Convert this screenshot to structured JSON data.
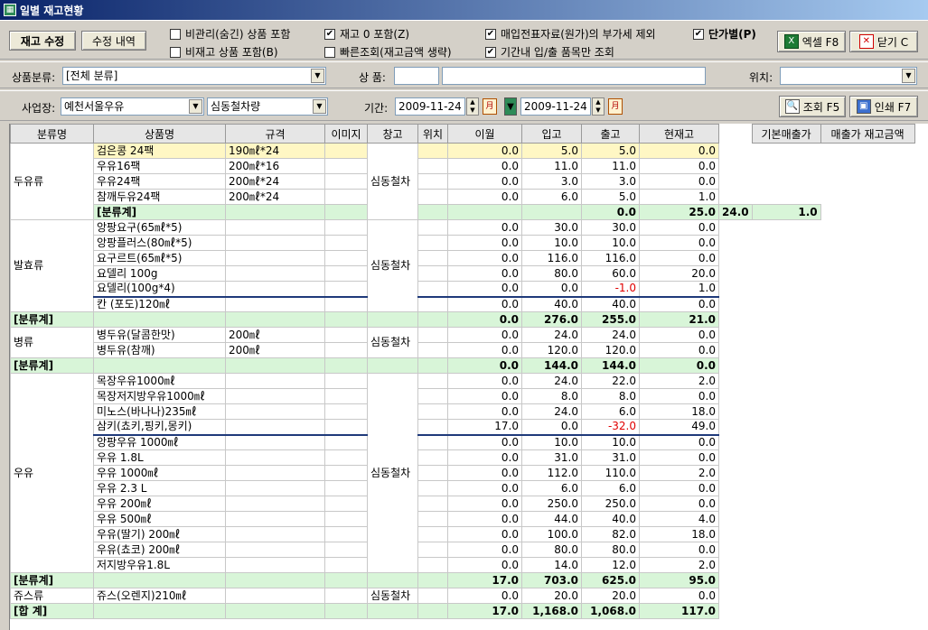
{
  "window": {
    "title": "일별 재고현황"
  },
  "toolbar": {
    "stock_edit": "재고 수정",
    "edit_history": "수정 내역",
    "chk_unmanaged": "비관리(숨긴) 상품 포함",
    "chk_nonstock": "비재고 상품 포함(B)",
    "chk_zero_stock": "재고 0 포함(Z)",
    "chk_quick": "빠른조회(재고금액 생략)",
    "chk_vat": "매입전표자료(원가)의 부가세 제외",
    "chk_period": "기간내 입/출 품목만 조회",
    "chk_unit_price": "단가별(P)",
    "excel": "엑셀 F8",
    "close": "닫기 C",
    "query": "조회 F5",
    "print": "인쇄 F7",
    "checked": "✔"
  },
  "filters": {
    "category_label": "상품분류:",
    "category_value": "[전체 분류]",
    "product_label": "상  품:",
    "location_label": "위치:",
    "site_label": "사업장:",
    "site_value": "예천서울우유",
    "warehouse_value": "심동철차량",
    "period_label": "기간:",
    "date_from": "2009-11-24",
    "date_to": "2009-11-24",
    "cal_glyph": "月"
  },
  "columns": [
    "분류명",
    "상품명",
    "규격",
    "이미지",
    "창고",
    "위치",
    "이월",
    "입고",
    "출고",
    "현재고",
    "기본매출가",
    "매출가 재고금액"
  ],
  "groups": {
    "g1": {
      "cat": "두유류",
      "wh": "심동철차"
    },
    "g2": {
      "cat": "발효류",
      "wh": "심동철차"
    },
    "g3": {
      "cat": "병류",
      "wh": "심동철차"
    },
    "g4": {
      "cat": "우유",
      "wh": "심동철차"
    },
    "g5": {
      "cat": "쥬스류",
      "wh": "심동철차"
    }
  },
  "rows": {
    "r0": {
      "name": "검은콩 24팩",
      "spec": "190㎖*24",
      "carry": "0.0",
      "in": "5.0",
      "out": "5.0",
      "stock": "0.0"
    },
    "r1": {
      "name": "우유16팩",
      "spec": "200㎖*16",
      "carry": "0.0",
      "in": "11.0",
      "out": "11.0",
      "stock": "0.0"
    },
    "r2": {
      "name": "우유24팩",
      "spec": "200㎖*24",
      "carry": "0.0",
      "in": "3.0",
      "out": "3.0",
      "stock": "0.0"
    },
    "r3": {
      "name": "참깨두유24팩",
      "spec": "200㎖*24",
      "carry": "0.0",
      "in": "6.0",
      "out": "5.0",
      "stock": "1.0"
    },
    "s1": {
      "label": "[분류계]",
      "carry": "0.0",
      "in": "25.0",
      "out": "24.0",
      "stock": "1.0"
    },
    "r4": {
      "name": "앙팡요구(65㎖*5)",
      "carry": "0.0",
      "in": "30.0",
      "out": "30.0",
      "stock": "0.0"
    },
    "r5": {
      "name": "앙팡플러스(80㎖*5)",
      "carry": "0.0",
      "in": "10.0",
      "out": "10.0",
      "stock": "0.0"
    },
    "r6": {
      "name": "요구르트(65㎖*5)",
      "carry": "0.0",
      "in": "116.0",
      "out": "116.0",
      "stock": "0.0"
    },
    "r7": {
      "name": "요델리 100g",
      "carry": "0.0",
      "in": "80.0",
      "out": "60.0",
      "stock": "20.0"
    },
    "r8": {
      "name": "요델리(100g*4)",
      "carry": "0.0",
      "in": "0.0",
      "out": "-1.0",
      "stock": "1.0"
    },
    "r9": {
      "name": "칸 (포도)120㎖",
      "carry": "0.0",
      "in": "40.0",
      "out": "40.0",
      "stock": "0.0"
    },
    "s2": {
      "label": "[분류계]",
      "carry": "0.0",
      "in": "276.0",
      "out": "255.0",
      "stock": "21.0"
    },
    "r10": {
      "name": "병두유(달콤한맛)",
      "spec": "200㎖",
      "carry": "0.0",
      "in": "24.0",
      "out": "24.0",
      "stock": "0.0"
    },
    "r11": {
      "name": "병두유(참깨)",
      "spec": "200㎖",
      "carry": "0.0",
      "in": "120.0",
      "out": "120.0",
      "stock": "0.0"
    },
    "s3": {
      "label": "[분류계]",
      "carry": "0.0",
      "in": "144.0",
      "out": "144.0",
      "stock": "0.0"
    },
    "r12": {
      "name": "목장우유1000㎖",
      "carry": "0.0",
      "in": "24.0",
      "out": "22.0",
      "stock": "2.0"
    },
    "r13": {
      "name": "목장저지방우유1000㎖",
      "carry": "0.0",
      "in": "8.0",
      "out": "8.0",
      "stock": "0.0"
    },
    "r14": {
      "name": "미노스(바나나)235㎖",
      "carry": "0.0",
      "in": "24.0",
      "out": "6.0",
      "stock": "18.0"
    },
    "r15": {
      "name": "삼키(쵸키,핑키,몽키)",
      "carry": "17.0",
      "in": "0.0",
      "out": "-32.0",
      "stock": "49.0"
    },
    "r16": {
      "name": "앙팡우유 1000㎖",
      "carry": "0.0",
      "in": "10.0",
      "out": "10.0",
      "stock": "0.0"
    },
    "r17": {
      "name": "우유 1.8L",
      "carry": "0.0",
      "in": "31.0",
      "out": "31.0",
      "stock": "0.0"
    },
    "r18": {
      "name": "우유 1000㎖",
      "carry": "0.0",
      "in": "112.0",
      "out": "110.0",
      "stock": "2.0"
    },
    "r19": {
      "name": "우유 2.3 L",
      "carry": "0.0",
      "in": "6.0",
      "out": "6.0",
      "stock": "0.0"
    },
    "r20": {
      "name": "우유 200㎖",
      "carry": "0.0",
      "in": "250.0",
      "out": "250.0",
      "stock": "0.0"
    },
    "r21": {
      "name": "우유 500㎖",
      "carry": "0.0",
      "in": "44.0",
      "out": "40.0",
      "stock": "4.0"
    },
    "r22": {
      "name": "우유(딸기) 200㎖",
      "carry": "0.0",
      "in": "100.0",
      "out": "82.0",
      "stock": "18.0"
    },
    "r23": {
      "name": "우유(쵸코) 200㎖",
      "carry": "0.0",
      "in": "80.0",
      "out": "80.0",
      "stock": "0.0"
    },
    "r24": {
      "name": "저지방우유1.8L",
      "carry": "0.0",
      "in": "14.0",
      "out": "12.0",
      "stock": "2.0"
    },
    "s4": {
      "label": "[분류계]",
      "carry": "17.0",
      "in": "703.0",
      "out": "625.0",
      "stock": "95.0"
    },
    "r25": {
      "name": "쥬스(오렌지)210㎖",
      "carry": "0.0",
      "in": "20.0",
      "out": "20.0",
      "stock": "0.0"
    },
    "tot": {
      "label": "[합  계]",
      "carry": "17.0",
      "in": "1,168.0",
      "out": "1,068.0",
      "stock": "117.0"
    }
  }
}
